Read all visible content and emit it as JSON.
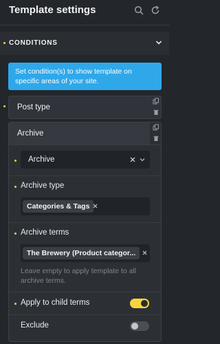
{
  "header": {
    "title": "Template settings",
    "search_icon": "search-icon",
    "refresh_icon": "refresh-icon"
  },
  "conditions": {
    "label": "CONDITIONS",
    "info": "Set condition(s) to show template on specific areas of your site."
  },
  "post_type": {
    "label": "Post type"
  },
  "archive_card": {
    "label": "Archive",
    "select_value": "Archive",
    "archive_type_label": "Archive type",
    "archive_type_tag": "Categories & Tags",
    "archive_terms_label": "Archive terms",
    "archive_terms_tag": "The Brewery (Product categor...",
    "archive_terms_hint": "Leave empty to apply template to all archive terms.",
    "apply_child_label": "Apply to child terms",
    "apply_child_on": true,
    "exclude_label": "Exclude",
    "exclude_on": false
  },
  "colors": {
    "accent": "#f7d43d",
    "info": "#2fa8ea",
    "background": "#23262b"
  }
}
